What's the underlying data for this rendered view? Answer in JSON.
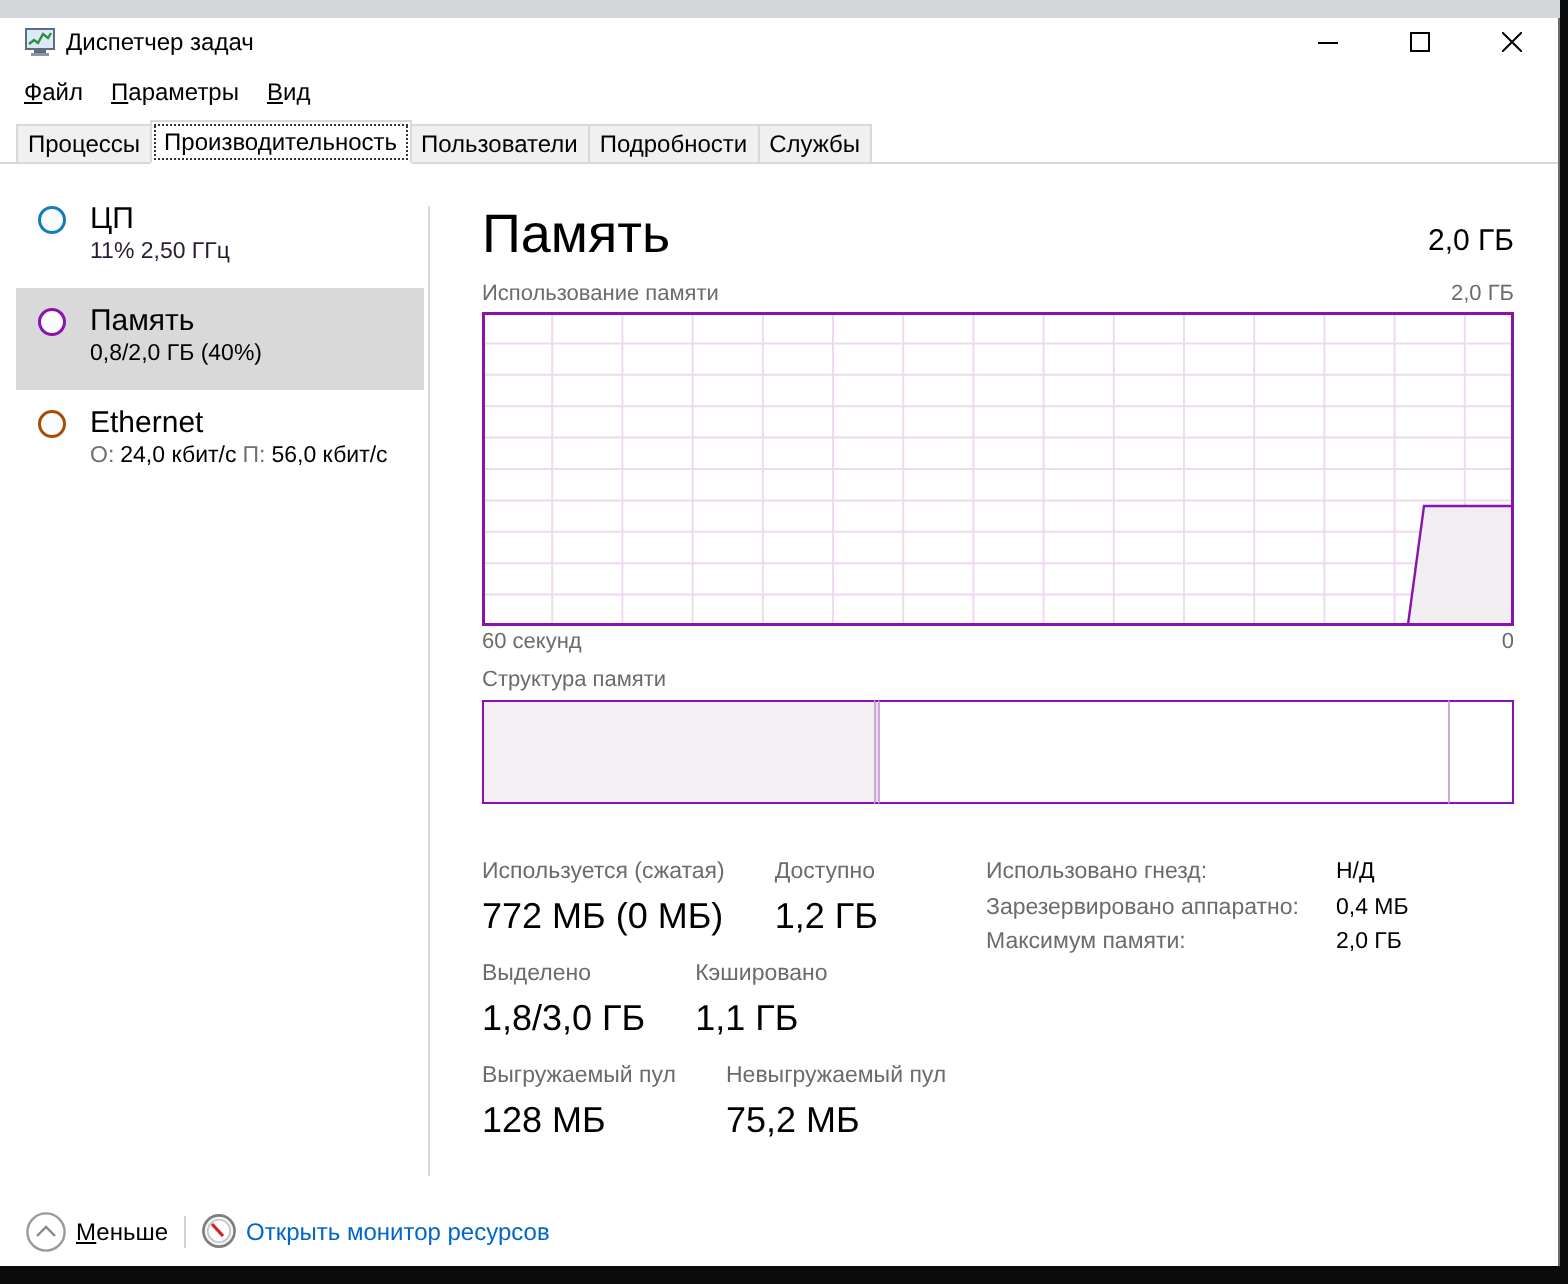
{
  "window": {
    "title": "Диспетчер задач"
  },
  "menu": [
    "Файл",
    "Параметры",
    "Вид"
  ],
  "tabs": [
    {
      "label": "Процессы",
      "selected": false
    },
    {
      "label": "Производительность",
      "selected": true
    },
    {
      "label": "Пользователи",
      "selected": false
    },
    {
      "label": "Подробности",
      "selected": false
    },
    {
      "label": "Службы",
      "selected": false
    }
  ],
  "sidebar": {
    "items": [
      {
        "title": "ЦП",
        "color": "#117dbb",
        "selected": false,
        "details": [
          {
            "value": "11% 2,50 ГГц"
          }
        ]
      },
      {
        "title": "Память",
        "color": "#8b12ae",
        "selected": true,
        "details": [
          {
            "value": "0,8/2,0 ГБ (40%)"
          }
        ]
      },
      {
        "title": "Ethernet",
        "color": "#a74f01",
        "selected": false,
        "details": [
          {
            "label": "О:",
            "value": "24,0 кбит/с"
          },
          {
            "label": "П:",
            "value": "56,0 кбит/с"
          }
        ]
      }
    ]
  },
  "panel": {
    "title": "Память",
    "capacity": "2,0 ГБ",
    "usage_graph": {
      "label": "Использование памяти",
      "max": "2,0 ГБ",
      "x_start": "60 секунд",
      "x_end": "0"
    },
    "composition": {
      "label": "Структура памяти"
    },
    "stats": [
      {
        "items": [
          {
            "label": "Используется (сжатая)",
            "value": "772 МБ (0 МБ)"
          },
          {
            "label": "Доступно",
            "value": "1,2 ГБ"
          }
        ]
      },
      {
        "items": [
          {
            "label": "Выделено",
            "value": "1,8/3,0 ГБ"
          },
          {
            "label": "Кэшировано",
            "value": "1,1 ГБ"
          }
        ]
      },
      {
        "items": [
          {
            "label": "Выгружаемый пул",
            "value": "128 МБ"
          },
          {
            "label": "Невыгружаемый пул",
            "value": "75,2 МБ"
          }
        ]
      }
    ],
    "details": [
      {
        "label": "Использовано гнезд:",
        "value": "Н/Д"
      },
      {
        "label": "Зарезервировано аппаратно:",
        "value": "0,4 МБ"
      },
      {
        "label": "Максимум памяти:",
        "value": "2,0 ГБ"
      }
    ]
  },
  "footer": {
    "collapse": "Меньше",
    "link": "Открыть монитор ресурсов"
  }
}
